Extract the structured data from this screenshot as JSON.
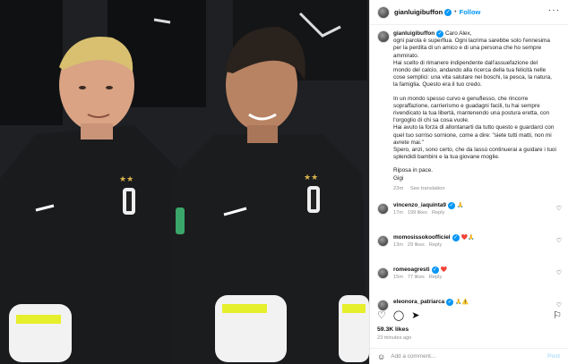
{
  "post": {
    "username": "gianluigibuffon",
    "follow_label": "Follow",
    "caption_lines": [
      "Caro Alex,",
      "ogni parola è superflua. Ogni lacrima sarebbe solo l'ennesima per la perdita di un amico e di una persona che ho sempre ammirato.",
      "Hai scelto di rimanere indipendente dall'assuefazione del mondo del calcio, andando alla ricerca della tua felicità nelle cose semplici: una vita salutare nei boschi, la pesca, la natura, la famiglia. Questo era il tuo credo.",
      "In un mondo spesso curvo e genuflesso, che rincorre sopraffazione, carrierismo e guadagni facili, tu hai sempre rivendicato la tua libertà, mantenendo una postura eretta, con l'orgoglio di chi sa cosa vuole.",
      "Hai avuto la forza di allontanarti da tutto questo e guardarci con quel tuo sorriso sornione, come a dire: \"siete tutti matti, non mi avrete mai.\"",
      "Spero, anzi, sono certo, che da lassù continuerai a guidare i tuoi splendidi bambini e la tua giovane moglie.",
      "Riposa in pace.",
      "Gigi"
    ],
    "caption_age": "23m",
    "see_translation": "See translation",
    "comments": [
      {
        "user": "vincenzo_iaquinta9",
        "emoji": "🙏",
        "age": "17m",
        "likes": "199 likes",
        "reply": "Reply"
      },
      {
        "user": "momosissokoofficiel",
        "emoji": "❤️🙏",
        "age": "13m",
        "likes": "29 likes",
        "reply": "Reply"
      },
      {
        "user": "romeoagresti",
        "emoji": "❤️",
        "age": "15m",
        "likes": "77 likes",
        "reply": "Reply"
      },
      {
        "user": "eleonora_patriarca",
        "emoji": "🙏⚠️",
        "age": "",
        "likes": "",
        "reply": ""
      }
    ],
    "likes_count": "59.3K likes",
    "time_ago": "23 minutes ago",
    "add_comment_placeholder": "Add a comment...",
    "post_label": "Post",
    "colors": {
      "accent": "#0095f6",
      "muted": "#8e8e8e",
      "jersey": "#151617"
    }
  }
}
